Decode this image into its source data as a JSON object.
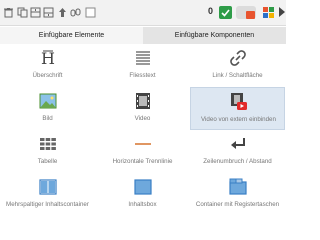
{
  "toolbar": {
    "icons": [
      "trash-icon",
      "copy-icon",
      "insert-above-icon",
      "insert-below-icon",
      "upload-icon",
      "link-icon",
      "checkbox-icon"
    ],
    "count": "0",
    "status_color": "#2e9c48",
    "accent_color": "#e8542f"
  },
  "tabs": [
    {
      "label": "Einfügbare Elemente",
      "active": true
    },
    {
      "label": "Einfügbare Komponenten",
      "active": false
    }
  ],
  "elements": [
    {
      "label": "Überschrift",
      "icon": "heading-icon"
    },
    {
      "label": "Fliesstext",
      "icon": "paragraph-icon"
    },
    {
      "label": "Link / Schaltfläche",
      "icon": "link-icon"
    },
    {
      "label": "Bild",
      "icon": "image-icon"
    },
    {
      "label": "Video",
      "icon": "video-icon"
    },
    {
      "label": "Video von extern einbinden",
      "icon": "external-video-icon",
      "selected": true
    },
    {
      "label": "Tabelle",
      "icon": "table-icon"
    },
    {
      "label": "Horizontale Trennlinie",
      "icon": "horizontal-rule-icon"
    },
    {
      "label": "Zeilenumbruch / Abstand",
      "icon": "line-break-icon"
    },
    {
      "label": "Mehrspaltiger Inhaltscontainer",
      "icon": "multi-column-icon"
    },
    {
      "label": "Inhaltsbox",
      "icon": "content-box-icon"
    },
    {
      "label": "Container mit Registertaschen",
      "icon": "tabs-container-icon"
    }
  ]
}
